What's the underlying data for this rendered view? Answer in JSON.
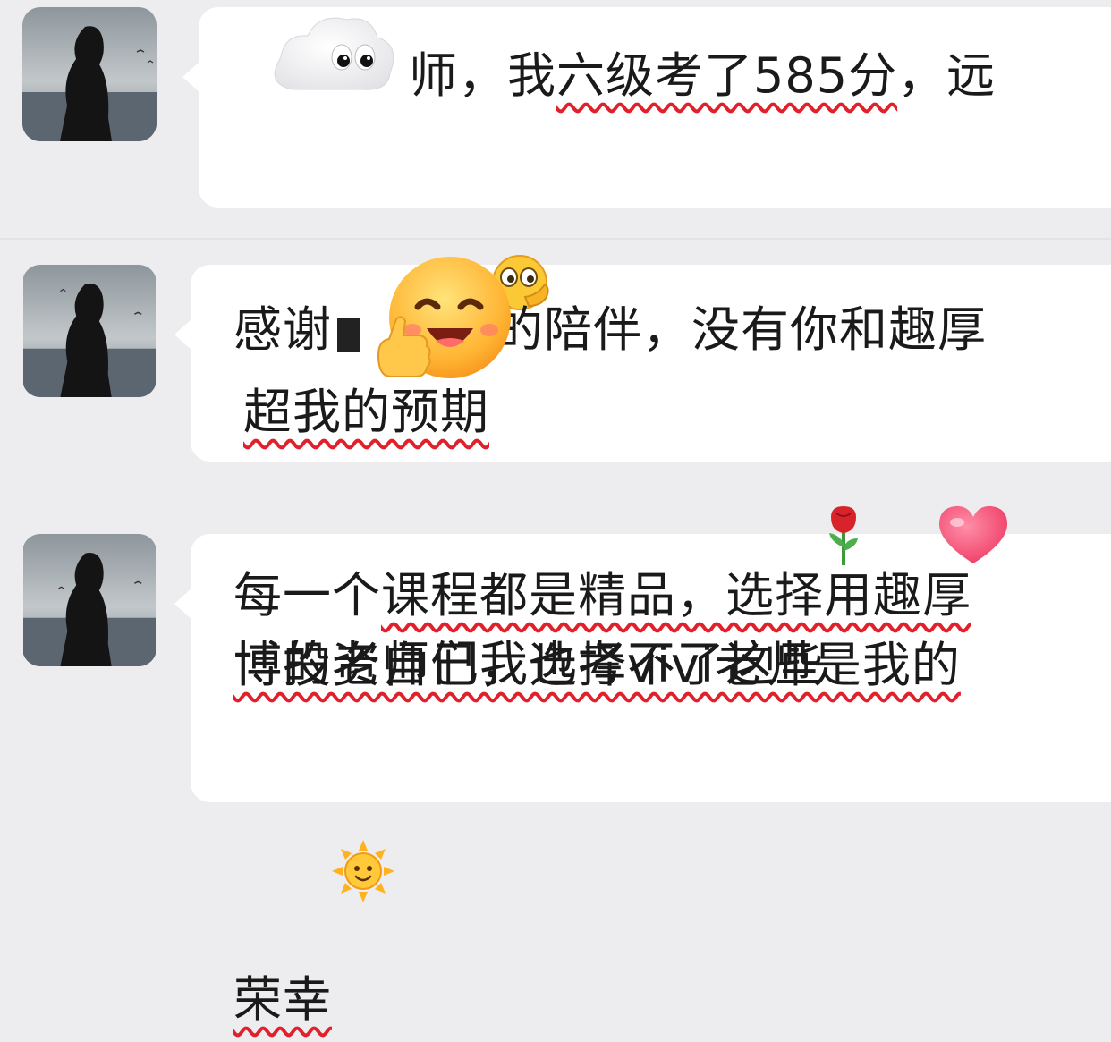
{
  "chat": {
    "messages": [
      {
        "sender_avatar": "avatar-girl-seaside",
        "line1_visible": "师，我",
        "line1_underlined": "六级考了585分",
        "line1_tail": "，远",
        "line2_underlined": "超我的预期",
        "emoji": "thinking-hand-face-emoji",
        "sticker": "cloud-eyes-sticker"
      },
      {
        "sender_avatar": "avatar-girl-seaside",
        "line1_visible": "感谢",
        "line1_tail": "的陪伴，没有你和趣厚",
        "line2": "博的老师们我也考不了这些",
        "emojis": [
          "rose-emoji",
          "heart-emoji"
        ],
        "sticker": "laughing-thumbs-up-sticker"
      },
      {
        "sender_avatar": "avatar-girl-seaside",
        "line1_plain": "每一个",
        "line1_underlined": "课程都是精品，选择用趣厚",
        "line2_underlined": "博投资自己，选择vivi老师是我的",
        "line3_underlined": "荣幸",
        "emoji": "sun-emoji"
      }
    ]
  },
  "colors": {
    "background": "#ededf0",
    "bubble": "#ffffff",
    "underline": "#e0202a"
  }
}
